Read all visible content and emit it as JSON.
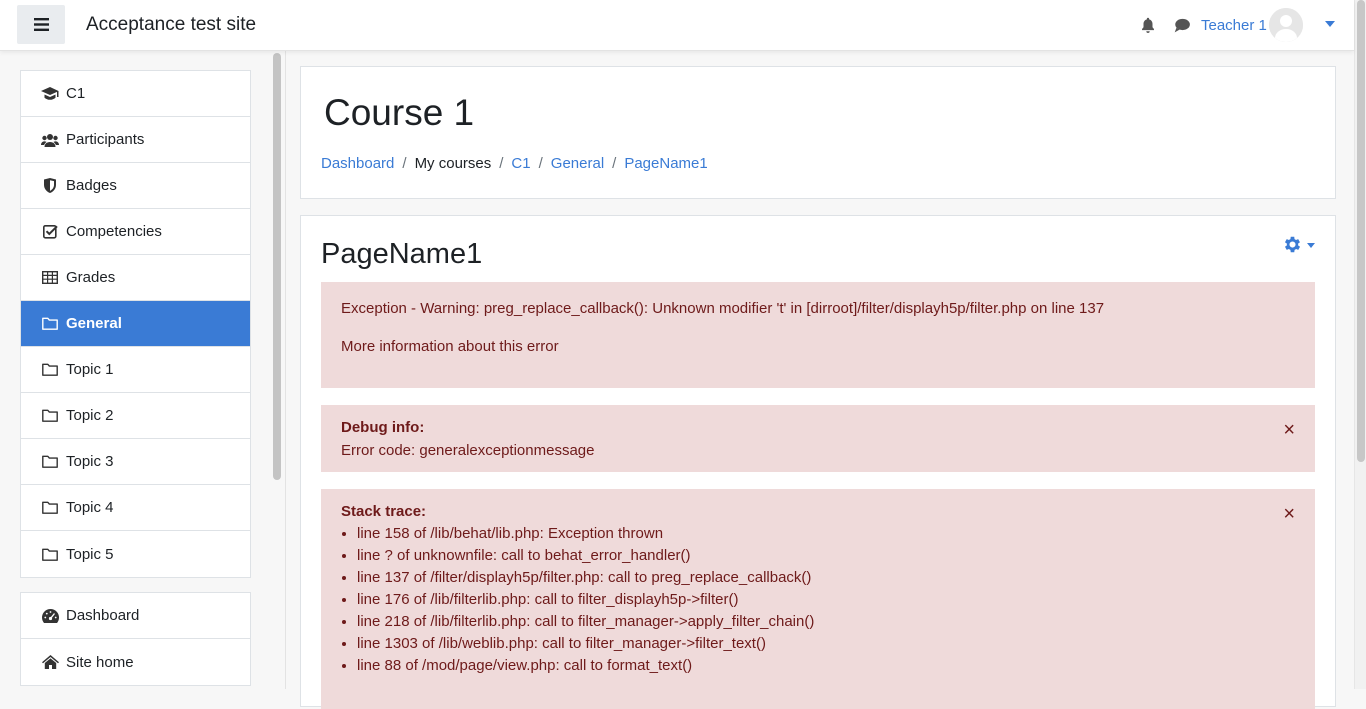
{
  "header": {
    "site_name": "Acceptance test site",
    "user_name": "Teacher 1",
    "icons": [
      "menu-icon",
      "bell-icon",
      "chat-icon",
      "avatar",
      "chevron-down-icon"
    ]
  },
  "drawer": {
    "course_items": [
      {
        "label": "C1",
        "icon": "graduation-cap-icon"
      },
      {
        "label": "Participants",
        "icon": "users-icon"
      },
      {
        "label": "Badges",
        "icon": "shield-icon"
      },
      {
        "label": "Competencies",
        "icon": "check-square-icon"
      },
      {
        "label": "Grades",
        "icon": "table-icon"
      },
      {
        "label": "General",
        "icon": "folder-icon",
        "active": true
      },
      {
        "label": "Topic 1",
        "icon": "folder-icon"
      },
      {
        "label": "Topic 2",
        "icon": "folder-icon"
      },
      {
        "label": "Topic 3",
        "icon": "folder-icon"
      },
      {
        "label": "Topic 4",
        "icon": "folder-icon"
      },
      {
        "label": "Topic 5",
        "icon": "folder-icon"
      }
    ],
    "site_items": [
      {
        "label": "Dashboard",
        "icon": "dashboard-icon"
      },
      {
        "label": "Site home",
        "icon": "home-icon"
      }
    ]
  },
  "course_header": {
    "title": "Course 1",
    "breadcrumb": [
      {
        "label": "Dashboard",
        "link": true
      },
      {
        "label": "My courses",
        "link": false
      },
      {
        "label": "C1",
        "link": true
      },
      {
        "label": "General",
        "link": true
      },
      {
        "label": "PageName1",
        "link": true
      }
    ],
    "separator": "/"
  },
  "main": {
    "page_title": "PageName1",
    "error": {
      "message": "Exception - Warning: preg_replace_callback(): Unknown modifier 't' in [dirroot]/filter/displayh5p/filter.php on line 137",
      "more_info": "More information about this error"
    },
    "debug": {
      "title": "Debug info:",
      "text": "Error code: generalexceptionmessage",
      "close": "×"
    },
    "stack": {
      "title": "Stack trace:",
      "close": "×",
      "lines": [
        "line 158 of /lib/behat/lib.php: Exception thrown",
        "line ? of unknownfile: call to behat_error_handler()",
        "line 137 of /filter/displayh5p/filter.php: call to preg_replace_callback()",
        "line 176 of /lib/filterlib.php: call to filter_displayh5p->filter()",
        "line 218 of /lib/filterlib.php: call to filter_manager->apply_filter_chain()",
        "line 1303 of /lib/weblib.php: call to filter_manager->filter_text()",
        "line 88 of /mod/page/view.php: call to format_text()"
      ]
    }
  },
  "colors": {
    "accent": "#3a7bd5",
    "alert_bg": "#efdada",
    "alert_text": "#6e1a1a"
  }
}
